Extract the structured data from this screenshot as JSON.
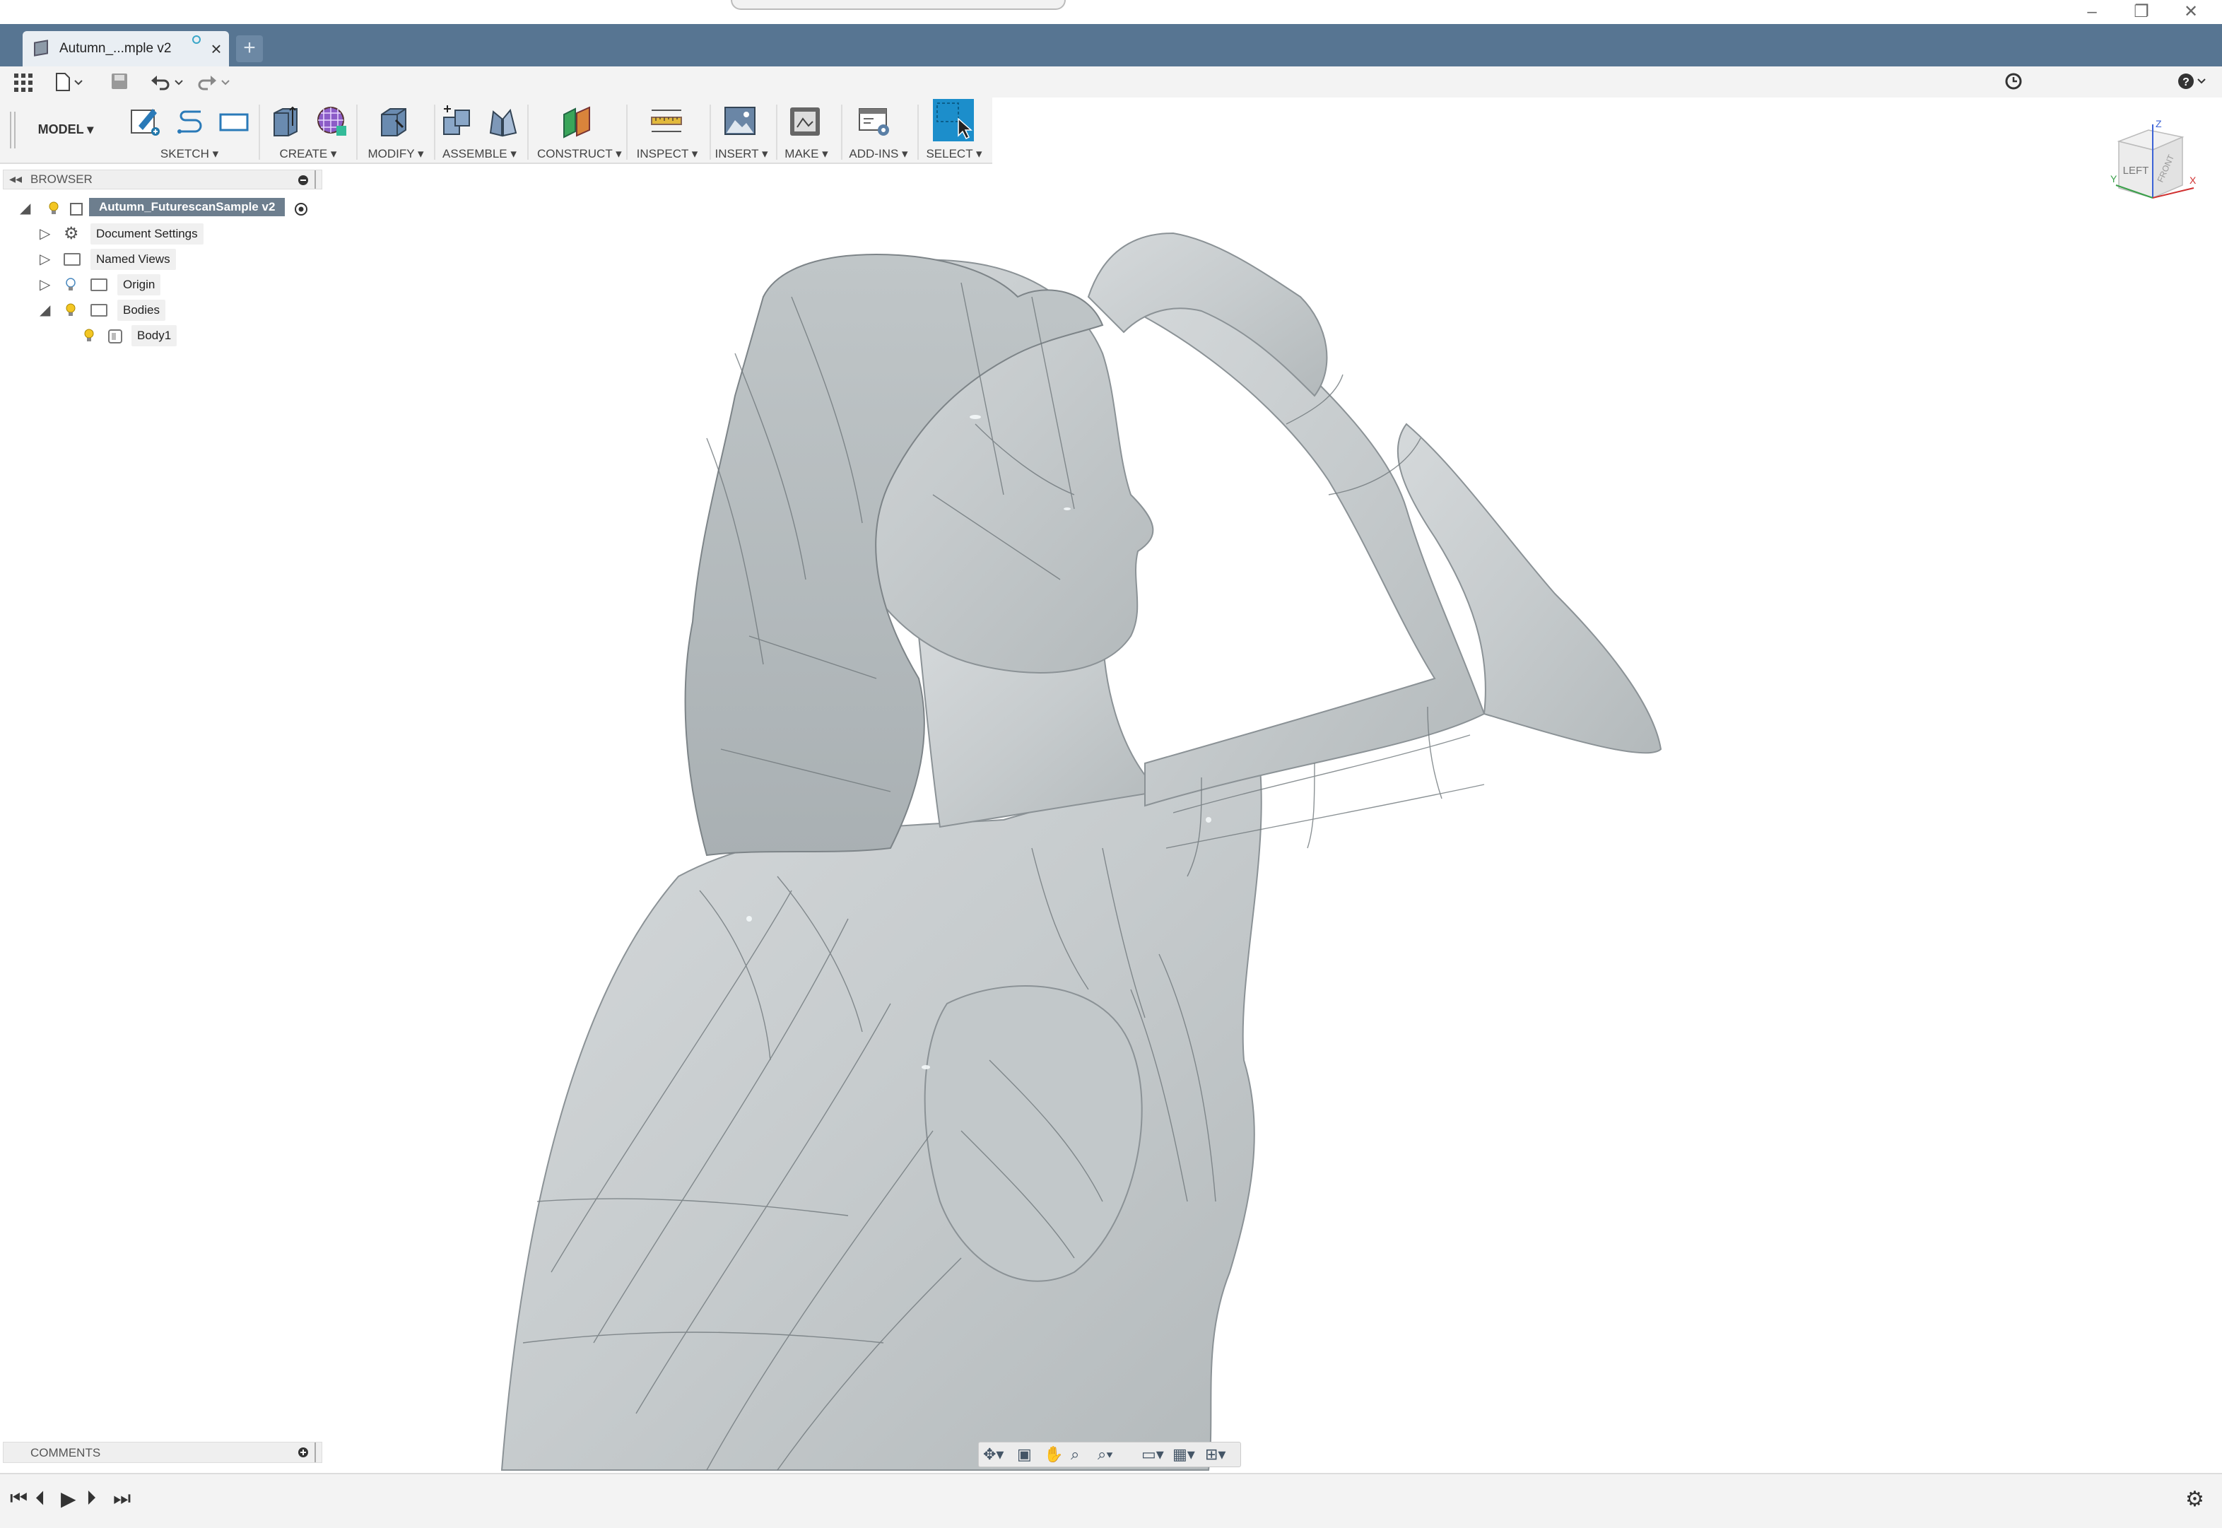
{
  "window": {
    "doc_tab_title": "Autumn_...mple v2",
    "new_tab_symbol": "+",
    "close_symbol": "×",
    "minimize": "–",
    "restore": "❐",
    "close": "✕"
  },
  "toolbar": {
    "mode": "MODEL ▾",
    "groups": {
      "sketch": "SKETCH ▾",
      "create": "CREATE ▾",
      "modify": "MODIFY ▾",
      "assemble": "ASSEMBLE ▾",
      "construct": "CONSTRUCT ▾",
      "inspect": "INSPECT ▾",
      "insert": "INSERT ▾",
      "make": "MAKE ▾",
      "addins": "ADD-INS ▾",
      "select": "SELECT ▾"
    }
  },
  "browser": {
    "title": "BROWSER",
    "root": "Autumn_FuturescanSample v2",
    "items": [
      {
        "label": "Document Settings",
        "icon": "gear-icon"
      },
      {
        "label": "Named Views",
        "icon": "folder-icon"
      },
      {
        "label": "Origin",
        "icon": "folder-icon"
      },
      {
        "label": "Bodies",
        "icon": "folder-icon"
      },
      {
        "label": "Body1",
        "icon": "body-icon"
      }
    ]
  },
  "comments": {
    "title": "COMMENTS"
  },
  "viewcube": {
    "face": "LEFT",
    "side": "FRONT",
    "axis_z": "Z",
    "axis_x": "X",
    "axis_y": "Y"
  },
  "colors": {
    "tabbar": "#577592",
    "model_surface": "#c9ced0",
    "select_accent": "#1c8ecb"
  }
}
